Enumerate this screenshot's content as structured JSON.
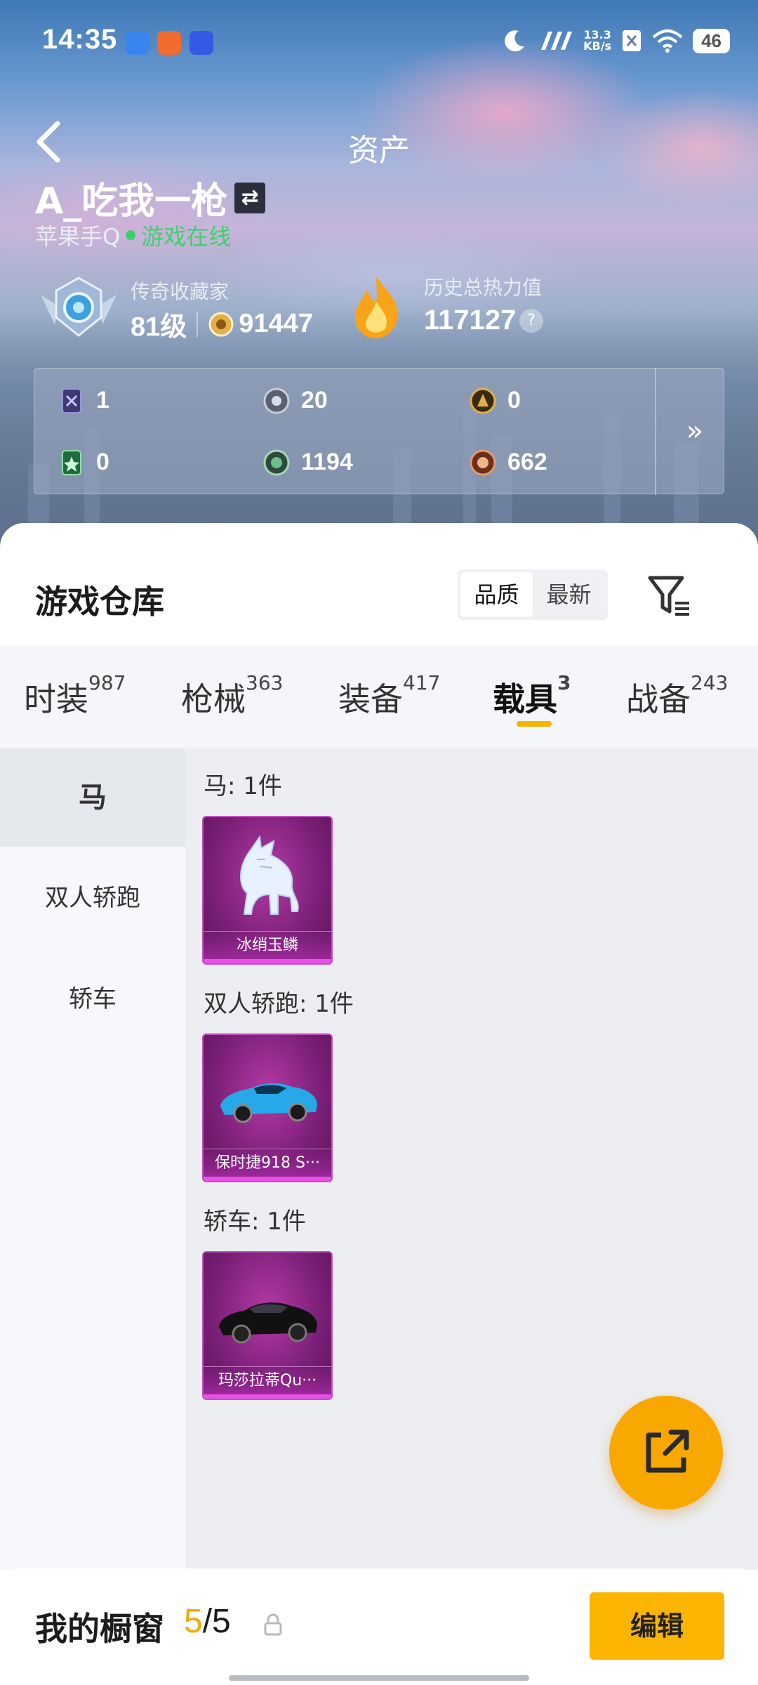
{
  "status_bar": {
    "time": "14:35",
    "net_speed_value": "13.3",
    "net_speed_unit": "KB/s",
    "battery": "46"
  },
  "header": {
    "title": "资产",
    "player_name": "A_吃我一枪",
    "platform": "苹果手Q",
    "online_status": "游戏在线",
    "collector_title": "传奇收藏家",
    "level": "81级",
    "medal_points": "91447",
    "heat_title": "历史总热力值",
    "heat_value": "117127",
    "help": "?"
  },
  "currencies": [
    {
      "icon": "card-icon",
      "value": "1"
    },
    {
      "icon": "silver-coin-icon",
      "value": "20"
    },
    {
      "icon": "gold-coin-icon",
      "value": "0"
    },
    {
      "icon": "green-card-icon",
      "value": "0"
    },
    {
      "icon": "green-coin-icon",
      "value": "1194"
    },
    {
      "icon": "bronze-coin-icon",
      "value": "662"
    }
  ],
  "warehouse": {
    "title": "游戏仓库",
    "sort_options": [
      "品质",
      "最新"
    ],
    "selected_sort": "品质"
  },
  "tabs": [
    {
      "label": "时装",
      "count": "987"
    },
    {
      "label": "枪械",
      "count": "363"
    },
    {
      "label": "装备",
      "count": "417"
    },
    {
      "label": "载具",
      "count": "3"
    },
    {
      "label": "战备",
      "count": "243"
    }
  ],
  "active_tab": "载具",
  "sidebar": [
    "马",
    "双人轿跑",
    "轿车"
  ],
  "groups": [
    {
      "label": "马: 1件",
      "item": "冰绡玉鳞"
    },
    {
      "label": "双人轿跑: 1件",
      "item": "保时捷918 S···"
    },
    {
      "label": "轿车: 1件",
      "item": "玛莎拉蒂Qu···"
    }
  ],
  "footer": {
    "label": "我的橱窗",
    "count_current": "5",
    "count_sep": "/",
    "count_total": "5",
    "edit_label": "编辑"
  },
  "colors": {
    "accent": "#f5b400",
    "online": "#3bd26b",
    "card_purple": "#a12aa0"
  }
}
